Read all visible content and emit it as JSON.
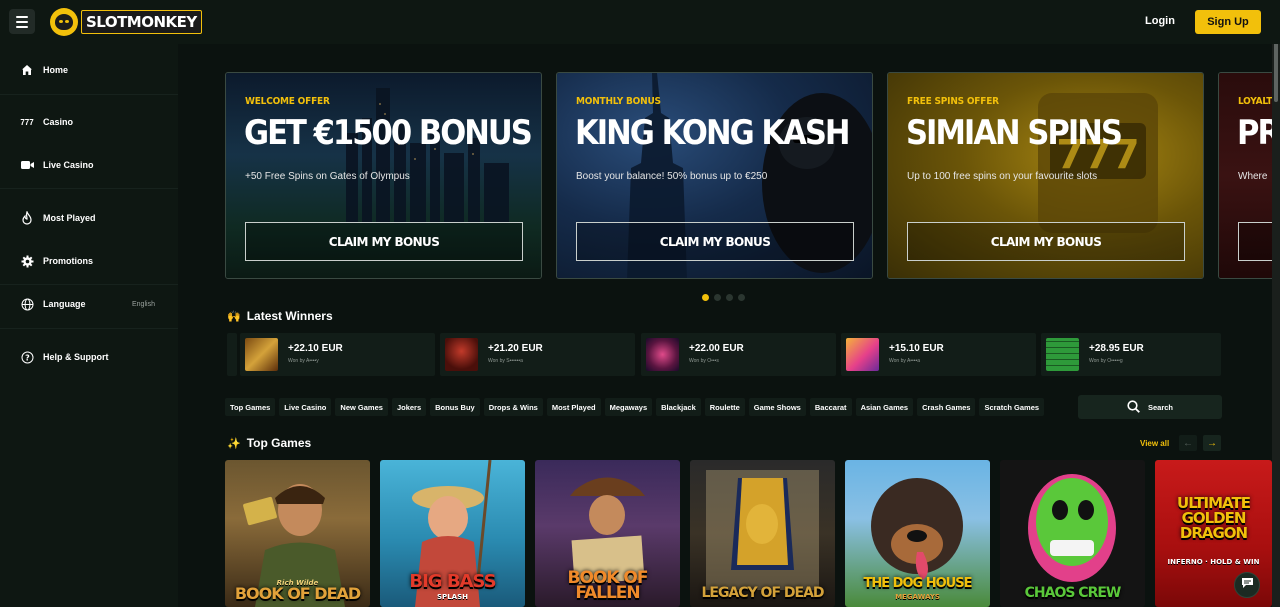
{
  "header": {
    "logo_text": "SLOTMONKEY",
    "login_label": "Login",
    "signup_label": "Sign Up"
  },
  "sidebar": {
    "items": [
      {
        "label": "Home",
        "icon": "home-icon"
      },
      {
        "label": "Casino",
        "icon": "slots-777-icon"
      },
      {
        "label": "Live Casino",
        "icon": "video-camera-icon"
      },
      {
        "label": "Most Played",
        "icon": "flame-icon"
      },
      {
        "label": "Promotions",
        "icon": "gear-badge-icon"
      },
      {
        "label": "Language",
        "icon": "globe-icon",
        "value": "English"
      },
      {
        "label": "Help & Support",
        "icon": "help-circle-icon"
      }
    ]
  },
  "promos": [
    {
      "eyebrow": "WELCOME OFFER",
      "title": "GET €1500 BONUS",
      "desc": "+50 Free Spins on Gates of Olympus",
      "cta": "CLAIM MY BONUS"
    },
    {
      "eyebrow": "MONTHLY BONUS",
      "title": "KING KONG KASH",
      "desc": "Boost your balance! 50% bonus up to €250",
      "cta": "CLAIM MY BONUS"
    },
    {
      "eyebrow": "FREE SPINS OFFER",
      "title": "SIMIAN SPINS",
      "desc": "Up to 100 free spins on your favourite slots",
      "cta": "CLAIM MY BONUS"
    },
    {
      "eyebrow": "LOYALT",
      "title": "PR",
      "desc": "Where",
      "cta": ""
    }
  ],
  "carousel": {
    "slides": 4,
    "active": 1
  },
  "latest_winners": {
    "title": "Latest Winners",
    "items": [
      {
        "amount": "+22.10 EUR",
        "by": "Won by A••••y"
      },
      {
        "amount": "+21.20 EUR",
        "by": "Won by S••••••a"
      },
      {
        "amount": "+22.00 EUR",
        "by": "Won by O•••s"
      },
      {
        "amount": "+15.10 EUR",
        "by": "Won by A••••a"
      },
      {
        "amount": "+28.95 EUR",
        "by": "Won by O•••••g"
      }
    ]
  },
  "filters": [
    "Top Games",
    "Live Casino",
    "New Games",
    "Jokers",
    "Bonus Buy",
    "Drops & Wins",
    "Most Played",
    "Megaways",
    "Blackjack",
    "Roulette",
    "Game Shows",
    "Baccarat",
    "Asian Games",
    "Crash Games",
    "Scratch Games"
  ],
  "search": {
    "label": "Search"
  },
  "top_games": {
    "title": "Top Games",
    "view_all": "View all",
    "games": [
      {
        "name": "BOOK OF DEAD",
        "sub": "Rich Wilde"
      },
      {
        "name": "BIG BASS",
        "sub": "SPLASH"
      },
      {
        "name": "BOOK OF FALLEN",
        "sub": ""
      },
      {
        "name": "LEGACY OF DEAD",
        "sub": ""
      },
      {
        "name": "THE DOG HOUSE",
        "sub": "MEGAWAYS"
      },
      {
        "name": "CHAOS CREW",
        "sub": ""
      },
      {
        "name": "ULTIMATE GOLDEN DRAGON",
        "sub": "INFERNO · HOLD & WIN"
      }
    ]
  },
  "colors": {
    "accent": "#f2c00b",
    "bg": "#0b120f",
    "panel": "#0e1712"
  }
}
